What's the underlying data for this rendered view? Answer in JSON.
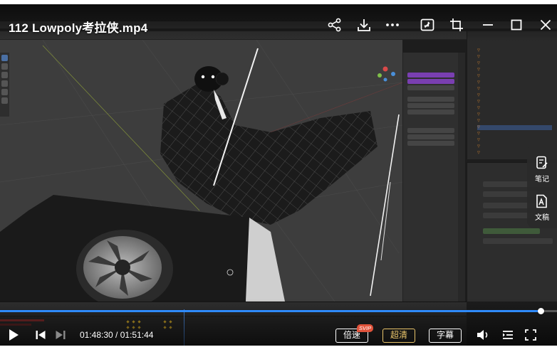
{
  "video": {
    "title": "112  Lowpoly考拉侠.mp4",
    "current_time": "01:48:30",
    "separator": " / ",
    "duration": "01:51:44",
    "progress_fraction": 0.971
  },
  "controls": {
    "speed_label": "倍速",
    "quality_label": "超清",
    "quality_badge": "SVIP",
    "subtitle_label": "字幕"
  },
  "side_panel": {
    "notes_label": "笔记",
    "doc_label": "文稿"
  },
  "icons": {
    "share": "share-icon",
    "download": "download-icon",
    "more": "more-icon",
    "pip": "picture-in-picture-icon",
    "crop": "crop-icon",
    "minimize": "minimize-icon",
    "maximize": "maximize-icon",
    "close": "close-icon",
    "play": "play-icon",
    "prev": "previous-icon",
    "next": "next-icon",
    "volume": "volume-icon",
    "playlist": "playlist-icon",
    "fullscreen": "fullscreen-icon"
  },
  "colors": {
    "progress": "#2f8bff",
    "quality_gold": "#e9c46a",
    "svip_badge": "#e0533b"
  }
}
